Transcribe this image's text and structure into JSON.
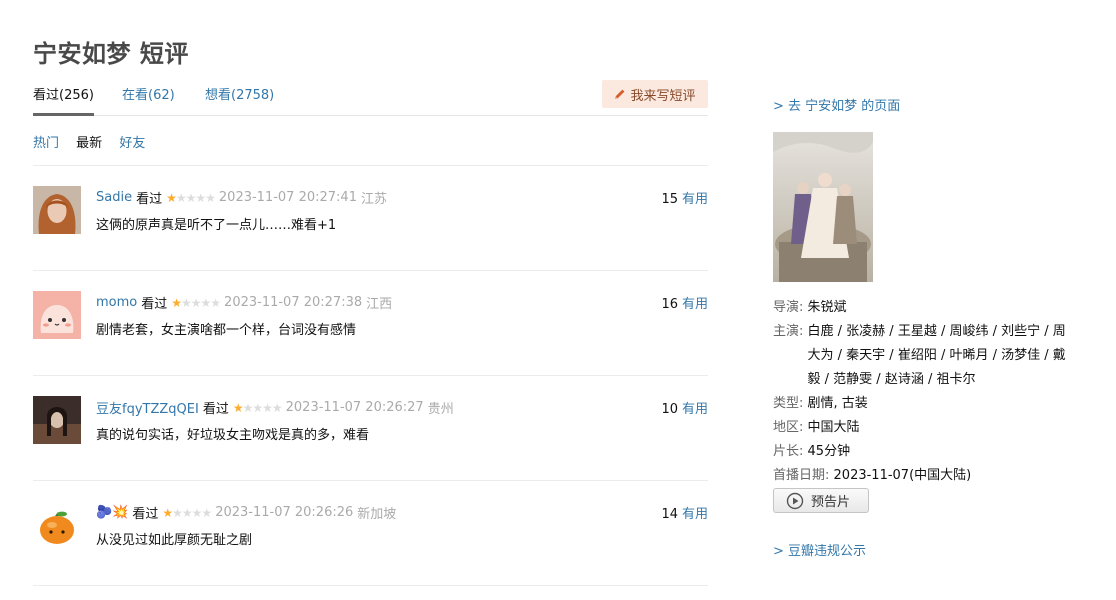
{
  "page_title": "宁安如梦 短评",
  "tabs": [
    {
      "label": "看过(256)"
    },
    {
      "label": "在看(62)"
    },
    {
      "label": "想看(2758)"
    }
  ],
  "write_button": "我来写短评",
  "sorts": [
    "热门",
    "最新",
    "好友"
  ],
  "comments": [
    {
      "user": "Sadie",
      "status": "看过",
      "rating": 1,
      "time": "2023-11-07 20:27:41",
      "location": "江苏",
      "content": "这俩的原声真是听不了一点儿……难看+1",
      "votes": "15",
      "useful": "有用",
      "avatar_icon": "avatar-photo-woman"
    },
    {
      "user": "momo",
      "status": "看过",
      "rating": 1,
      "time": "2023-11-07 20:27:38",
      "location": "江西",
      "content": "剧情老套，女主演啥都一个样，台词没有感情",
      "votes": "16",
      "useful": "有用",
      "avatar_icon": "avatar-cartoon-pink"
    },
    {
      "user": "豆友fqyTZZqQEI",
      "status": "看过",
      "rating": 1,
      "time": "2023-11-07 20:26:27",
      "location": "贵州",
      "content": "真的说句实话，好垃圾女主吻戏是真的多，难看",
      "votes": "10",
      "useful": "有用",
      "avatar_icon": "avatar-photo-dark"
    },
    {
      "user": "🫐💥",
      "status": "看过",
      "rating": 1,
      "time": "2023-11-07 20:26:26",
      "location": "新加坡",
      "content": "从没见过如此厚颜无耻之剧",
      "votes": "14",
      "useful": "有用",
      "avatar_icon": "avatar-orange"
    }
  ],
  "sidebar": {
    "back_link": "> 去 宁安如梦 的页面",
    "info": [
      {
        "label": "导演:",
        "value": "朱锐斌"
      },
      {
        "label": "主演:",
        "value": "白鹿 / 张凌赫 / 王星越 / 周峻纬 / 刘些宁 / 周大为 / 秦天宇 / 崔绍阳 / 叶晞月 / 汤梦佳 / 戴毅 / 范静雯 / 赵诗涵 / 祖卡尔"
      },
      {
        "label": "类型:",
        "value": "剧情, 古装"
      },
      {
        "label": "地区:",
        "value": "中国大陆"
      },
      {
        "label": "片长:",
        "value": "45分钟"
      },
      {
        "label": "首播日期:",
        "value": "2023-11-07(中国大陆)"
      }
    ],
    "trailer_button": "预告片",
    "report_link": "> 豆瓣违规公示"
  },
  "colors": {
    "link": "#3377aa",
    "star": "#ffac2d",
    "write_bg": "#fbe9df"
  }
}
